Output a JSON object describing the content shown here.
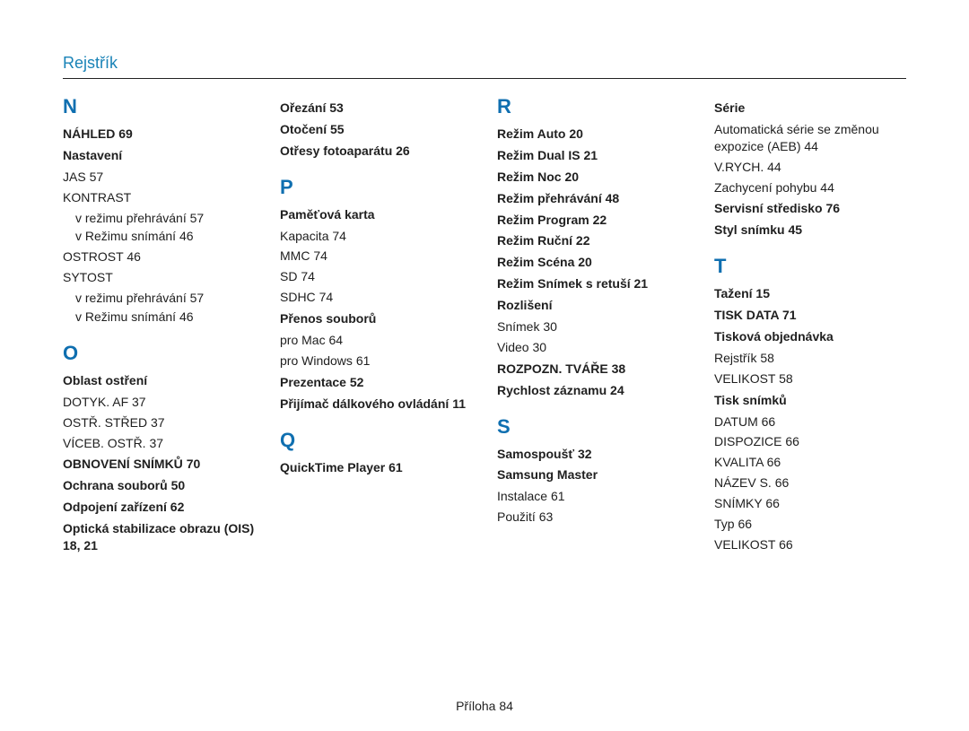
{
  "header": "Rejstřík",
  "footer_label": "Příloha",
  "footer_page": "84",
  "columns": [
    {
      "groups": [
        {
          "letter": "N",
          "items": [
            {
              "type": "entry",
              "label": "NÁHLED",
              "pages": "69"
            },
            {
              "type": "entry",
              "label": "Nastavení"
            },
            {
              "type": "sub",
              "label": "JAS",
              "pages": "57"
            },
            {
              "type": "sub",
              "label": "KONTRAST"
            },
            {
              "type": "subsub",
              "label": "v režimu přehrávání",
              "pages": "57"
            },
            {
              "type": "subsub",
              "label": "v Režimu snímání",
              "pages": "46"
            },
            {
              "type": "sub",
              "label": "OSTROST",
              "pages": "46"
            },
            {
              "type": "sub",
              "label": "SYTOST"
            },
            {
              "type": "subsub",
              "label": "v režimu přehrávání",
              "pages": "57"
            },
            {
              "type": "subsub",
              "label": "v Režimu snímání",
              "pages": "46"
            }
          ]
        },
        {
          "letter": "O",
          "items": [
            {
              "type": "entry",
              "label": "Oblast ostření"
            },
            {
              "type": "sub",
              "label": "DOTYK. AF",
              "pages": "37"
            },
            {
              "type": "sub",
              "label": "OSTŘ. STŘED",
              "pages": "37"
            },
            {
              "type": "sub",
              "label": "VÍCEB. OSTŘ.",
              "pages": "37"
            },
            {
              "type": "entry",
              "label": "OBNOVENÍ SNÍMKŮ",
              "pages": "70"
            },
            {
              "type": "entry",
              "label": "Ochrana souborů",
              "pages": "50"
            },
            {
              "type": "entry",
              "label": "Odpojení zařízení",
              "pages": "62"
            },
            {
              "type": "entry",
              "label": "Optická stabilizace obrazu (OIS)",
              "pages": "18, 21"
            }
          ]
        }
      ]
    },
    {
      "groups": [
        {
          "letter": "",
          "items": [
            {
              "type": "entry",
              "label": "Ořezání",
              "pages": "53"
            },
            {
              "type": "entry",
              "label": "Otočení",
              "pages": "55"
            },
            {
              "type": "entry",
              "label": "Otřesy fotoaparátu",
              "pages": "26"
            }
          ]
        },
        {
          "letter": "P",
          "items": [
            {
              "type": "entry",
              "label": "Paměťová karta"
            },
            {
              "type": "sub",
              "label": "Kapacita",
              "pages": "74"
            },
            {
              "type": "sub",
              "label": "MMC",
              "pages": "74"
            },
            {
              "type": "sub",
              "label": "SD",
              "pages": "74"
            },
            {
              "type": "sub",
              "label": "SDHC",
              "pages": "74"
            },
            {
              "type": "entry",
              "label": "Přenos souborů"
            },
            {
              "type": "sub",
              "label": "pro Mac",
              "pages": "64"
            },
            {
              "type": "sub",
              "label": "pro Windows",
              "pages": "61"
            },
            {
              "type": "entry",
              "label": "Prezentace",
              "pages": "52"
            },
            {
              "type": "entry",
              "label": "Přijímač dálkového ovládání",
              "pages": "11"
            }
          ]
        },
        {
          "letter": "Q",
          "items": [
            {
              "type": "entry",
              "label": "QuickTime Player",
              "pages": "61"
            }
          ]
        }
      ]
    },
    {
      "groups": [
        {
          "letter": "R",
          "items": [
            {
              "type": "entry",
              "label": "Režim Auto",
              "pages": "20"
            },
            {
              "type": "entry",
              "label": "Režim Dual IS",
              "pages": "21"
            },
            {
              "type": "entry",
              "label": "Režim Noc",
              "pages": "20"
            },
            {
              "type": "entry",
              "label": "Režim přehrávání",
              "pages": "48"
            },
            {
              "type": "entry",
              "label": "Režim Program",
              "pages": "22"
            },
            {
              "type": "entry",
              "label": "Režim Ruční",
              "pages": "22"
            },
            {
              "type": "entry",
              "label": "Režim Scéna",
              "pages": "20"
            },
            {
              "type": "entry",
              "label": "Režim Snímek s retuší",
              "pages": "21"
            },
            {
              "type": "entry",
              "label": "Rozlišení"
            },
            {
              "type": "sub",
              "label": "Snímek",
              "pages": "30"
            },
            {
              "type": "sub",
              "label": "Video",
              "pages": "30"
            },
            {
              "type": "entry",
              "label": "ROZPOZN. TVÁŘE",
              "pages": "38"
            },
            {
              "type": "entry",
              "label": "Rychlost záznamu",
              "pages": "24"
            }
          ]
        },
        {
          "letter": "S",
          "items": [
            {
              "type": "entry",
              "label": "Samospoušť",
              "pages": "32"
            },
            {
              "type": "entry",
              "label": "Samsung Master"
            },
            {
              "type": "sub",
              "label": "Instalace",
              "pages": "61"
            },
            {
              "type": "sub",
              "label": "Použití",
              "pages": "63"
            }
          ]
        }
      ]
    },
    {
      "groups": [
        {
          "letter": "",
          "items": [
            {
              "type": "entry",
              "label": "Série"
            },
            {
              "type": "sub",
              "label": "Automatická série se změnou expozice (AEB)",
              "pages": "44"
            },
            {
              "type": "sub",
              "label": "V.RYCH.",
              "pages": "44"
            },
            {
              "type": "sub",
              "label": "Zachycení pohybu",
              "pages": "44"
            },
            {
              "type": "entry",
              "label": "Servisní středisko",
              "pages": "76"
            },
            {
              "type": "entry",
              "label": "Styl snímku",
              "pages": "45"
            }
          ]
        },
        {
          "letter": "T",
          "items": [
            {
              "type": "entry",
              "label": "Tažení",
              "pages": "15"
            },
            {
              "type": "entry",
              "label": "TISK DATA",
              "pages": "71"
            },
            {
              "type": "entry",
              "label": "Tisková objednávka"
            },
            {
              "type": "sub",
              "label": "Rejstřík",
              "pages": "58"
            },
            {
              "type": "sub",
              "label": "VELIKOST",
              "pages": "58"
            },
            {
              "type": "entry",
              "label": "Tisk snímků"
            },
            {
              "type": "sub",
              "label": "DATUM",
              "pages": "66"
            },
            {
              "type": "sub",
              "label": "DISPOZICE",
              "pages": "66"
            },
            {
              "type": "sub",
              "label": "KVALITA",
              "pages": "66"
            },
            {
              "type": "sub",
              "label": "NÁZEV S.",
              "pages": "66"
            },
            {
              "type": "sub",
              "label": "SNÍMKY",
              "pages": "66"
            },
            {
              "type": "sub",
              "label": "Typ",
              "pages": "66"
            },
            {
              "type": "sub",
              "label": "VELIKOST",
              "pages": "66"
            }
          ]
        }
      ]
    }
  ]
}
